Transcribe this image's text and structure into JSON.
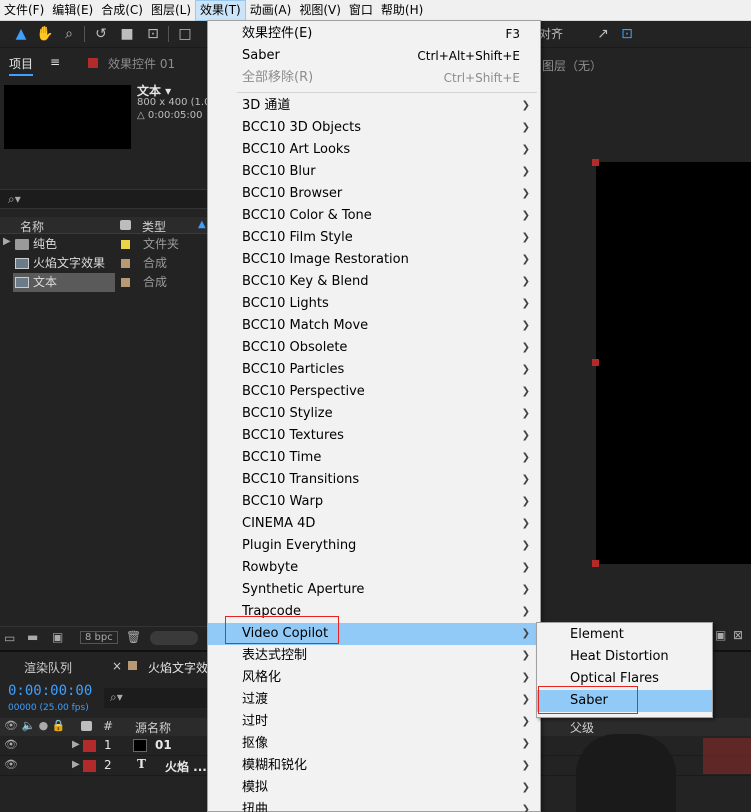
{
  "menubar": {
    "items": [
      {
        "label": "文件(F)"
      },
      {
        "label": "编辑(E)"
      },
      {
        "label": "合成(C)"
      },
      {
        "label": "图层(L)"
      },
      {
        "label": "效果(T)"
      },
      {
        "label": "动画(A)"
      },
      {
        "label": "视图(V)"
      },
      {
        "label": "窗口"
      },
      {
        "label": "帮助(H)"
      }
    ]
  },
  "toolbar": {
    "right_text": "对齐"
  },
  "project_panel": {
    "tab_project": "项目",
    "tab_menu": "≡",
    "tab_effects": "效果控件 01",
    "comp_name": "文本 ▾",
    "comp_size": "800 x 400 (1.00)",
    "comp_duration": "△ 0:00:05:00",
    "search_icon": "⌕▾",
    "col_name": "名称",
    "col_type": "类型",
    "rows": [
      {
        "name": "纯色",
        "type": "文件夹",
        "color": "#e8d34a"
      },
      {
        "name": "火焰文字效果",
        "type": "合成",
        "color": "#b79a74"
      },
      {
        "name": "文本",
        "type": "合成",
        "color": "#b79a74"
      }
    ],
    "bpc": "8 bpc"
  },
  "viewer": {
    "layer_label": "图层（无）"
  },
  "timeline": {
    "tab_render": "渲染队列",
    "tab_comp": "火焰文字效",
    "timecode": "0:00:00:00",
    "fps": "00000 (25.00 fps)",
    "col_num": "#",
    "col_source": "源名称",
    "col_parent": "父级",
    "layers": [
      {
        "num": "1",
        "name": "01"
      },
      {
        "num": "2",
        "name": "火焰 ..."
      }
    ]
  },
  "effects_menu": {
    "items": [
      {
        "label": "效果控件(E)",
        "shortcut": "F3",
        "disabled": false,
        "submenu": false
      },
      {
        "label": "Saber",
        "shortcut": "Ctrl+Alt+Shift+E",
        "disabled": false,
        "submenu": false
      },
      {
        "label": "全部移除(R)",
        "shortcut": "Ctrl+Shift+E",
        "disabled": true,
        "submenu": false
      },
      {
        "label": "3D 通道",
        "submenu": true
      },
      {
        "label": "BCC10 3D Objects",
        "submenu": true
      },
      {
        "label": "BCC10 Art Looks",
        "submenu": true
      },
      {
        "label": "BCC10 Blur",
        "submenu": true
      },
      {
        "label": "BCC10 Browser",
        "submenu": true
      },
      {
        "label": "BCC10 Color & Tone",
        "submenu": true
      },
      {
        "label": "BCC10 Film Style",
        "submenu": true
      },
      {
        "label": "BCC10 Image Restoration",
        "submenu": true
      },
      {
        "label": "BCC10 Key & Blend",
        "submenu": true
      },
      {
        "label": "BCC10 Lights",
        "submenu": true
      },
      {
        "label": "BCC10 Match Move",
        "submenu": true
      },
      {
        "label": "BCC10 Obsolete",
        "submenu": true
      },
      {
        "label": "BCC10 Particles",
        "submenu": true
      },
      {
        "label": "BCC10 Perspective",
        "submenu": true
      },
      {
        "label": "BCC10 Stylize",
        "submenu": true
      },
      {
        "label": "BCC10 Textures",
        "submenu": true
      },
      {
        "label": "BCC10 Time",
        "submenu": true
      },
      {
        "label": "BCC10 Transitions",
        "submenu": true
      },
      {
        "label": "BCC10 Warp",
        "submenu": true
      },
      {
        "label": "CINEMA 4D",
        "submenu": true
      },
      {
        "label": "Plugin Everything",
        "submenu": true
      },
      {
        "label": "Rowbyte",
        "submenu": true
      },
      {
        "label": "Synthetic Aperture",
        "submenu": true
      },
      {
        "label": "Trapcode",
        "submenu": true
      },
      {
        "label": "Video Copilot",
        "submenu": true,
        "highlighted": true
      },
      {
        "label": "表达式控制",
        "submenu": true
      },
      {
        "label": "风格化",
        "submenu": true
      },
      {
        "label": "过渡",
        "submenu": true
      },
      {
        "label": "过时",
        "submenu": true
      },
      {
        "label": "抠像",
        "submenu": true
      },
      {
        "label": "模糊和锐化",
        "submenu": true
      },
      {
        "label": "模拟",
        "submenu": true
      },
      {
        "label": "扭曲",
        "submenu": true
      }
    ]
  },
  "video_copilot_submenu": {
    "items": [
      {
        "label": "Element"
      },
      {
        "label": "Heat Distortion"
      },
      {
        "label": "Optical Flares"
      },
      {
        "label": "Saber",
        "highlighted": true
      }
    ]
  },
  "colors": {
    "menu_highlight": "#91c9f7",
    "annotation_red": "#e8221e",
    "timecode_blue": "#3d9fff"
  }
}
